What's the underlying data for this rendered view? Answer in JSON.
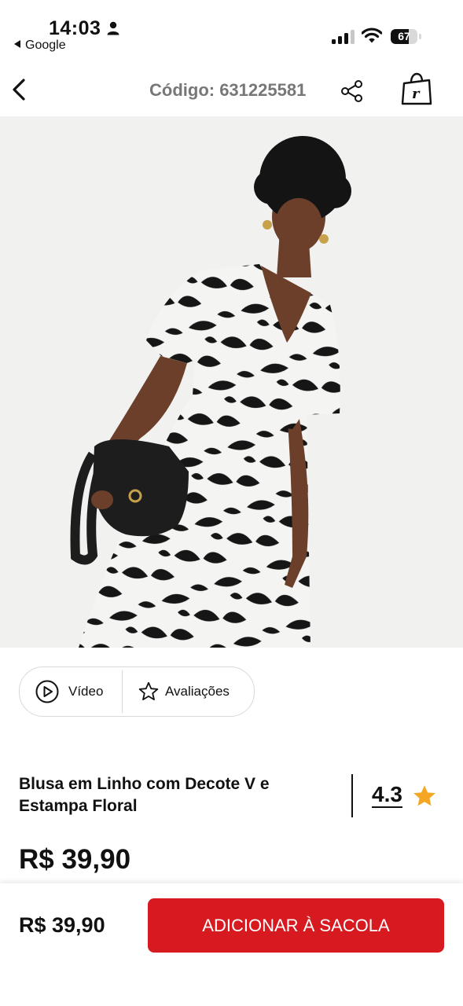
{
  "status_bar": {
    "time": "14:03",
    "back_app": "Google",
    "battery": "67",
    "battery_level": 0.67
  },
  "header": {
    "code": "Código: 631225581",
    "back_icon": "chevron-left-icon",
    "share_icon": "share-icon",
    "bag_icon": "shopping-bag-icon"
  },
  "media": {
    "video_label": "Vídeo",
    "reviews_label": "Avaliações"
  },
  "product": {
    "title": "Blusa em Linho com Decote V e Estampa Floral",
    "rating": "4.3",
    "price": "R$ 39,90"
  },
  "bottom_bar": {
    "price": "R$ 39,90",
    "add_button": "ADICIONAR À SACOLA"
  },
  "colors": {
    "accent": "#d71920",
    "star": "#f5a623",
    "code_text": "#777777"
  }
}
